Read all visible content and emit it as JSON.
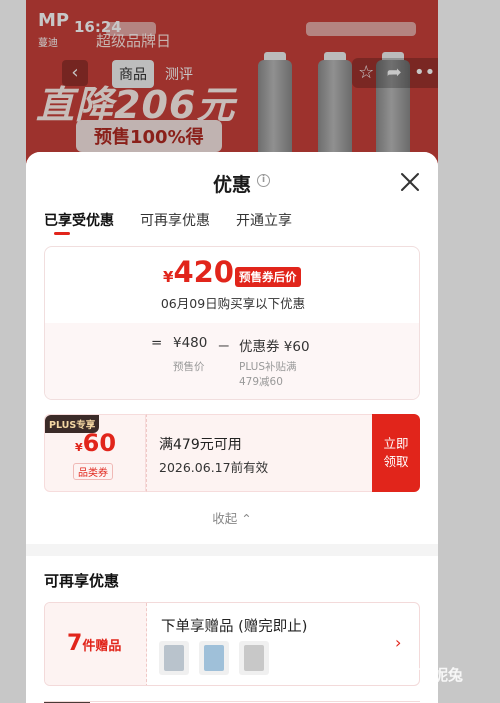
{
  "status_bar": {
    "time": "16:24"
  },
  "background": {
    "brand": "MP",
    "brand_sub": "蔓迪",
    "banner_top": "超级品牌日",
    "banner_big": "直降206元",
    "banner_pill": "预售100%得",
    "nav_back": "‹",
    "tabs": [
      "商品",
      "测评"
    ],
    "actions": [
      "☆",
      "➦",
      "•••"
    ]
  },
  "sheet": {
    "title": "优惠",
    "info_icon": "i",
    "close_icon": "close-icon",
    "tabs": [
      {
        "label": "已享受优惠",
        "active": true
      },
      {
        "label": "可再享优惠",
        "active": false
      },
      {
        "label": "开通立享",
        "active": false
      }
    ],
    "summary": {
      "currency": "¥",
      "final_price": "420",
      "tag": "预售券后价",
      "note": "06月09日购买享以下优惠",
      "equals": "=",
      "presale_price": "¥480",
      "presale_label": "预售价",
      "minus": "－",
      "coupon_label": "优惠券 ¥60",
      "coupon_sub1": "PLUS补贴满",
      "coupon_sub2": "479减60"
    },
    "coupon": {
      "badge": "PLUS专享",
      "currency": "¥",
      "amount": "60",
      "category": "品类券",
      "condition": "满479元可用",
      "valid": "2026.06.17前有效",
      "button_line1": "立即",
      "button_line2": "领取"
    },
    "collapse_label": "收起 ⌃"
  },
  "more_offers": {
    "title": "可再享优惠",
    "gift": {
      "count": "7",
      "unit": "件赠品",
      "title": "下单享赠品 (赠完即止)",
      "arrow": "›"
    }
  },
  "watermark": "可妮兔",
  "colors": {
    "accent": "#e1251b",
    "plus_dark": "#3b2b28",
    "plus_gold": "#f4d7a3"
  }
}
